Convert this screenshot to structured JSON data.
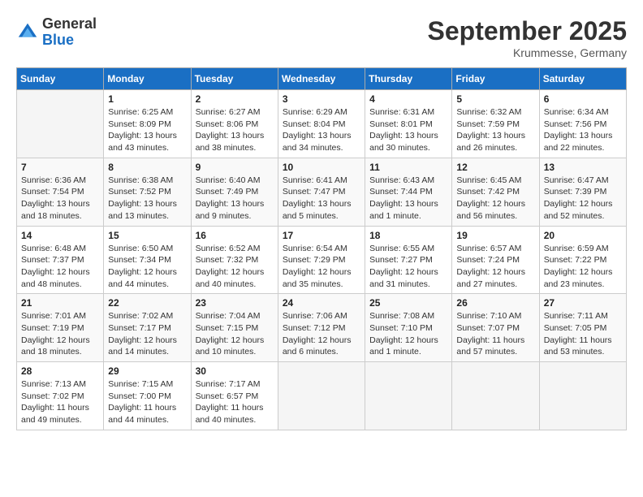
{
  "logo": {
    "general": "General",
    "blue": "Blue"
  },
  "title": "September 2025",
  "location": "Krummesse, Germany",
  "weekdays": [
    "Sunday",
    "Monday",
    "Tuesday",
    "Wednesday",
    "Thursday",
    "Friday",
    "Saturday"
  ],
  "weeks": [
    [
      {
        "day": "",
        "info": ""
      },
      {
        "day": "1",
        "info": "Sunrise: 6:25 AM\nSunset: 8:09 PM\nDaylight: 13 hours\nand 43 minutes."
      },
      {
        "day": "2",
        "info": "Sunrise: 6:27 AM\nSunset: 8:06 PM\nDaylight: 13 hours\nand 38 minutes."
      },
      {
        "day": "3",
        "info": "Sunrise: 6:29 AM\nSunset: 8:04 PM\nDaylight: 13 hours\nand 34 minutes."
      },
      {
        "day": "4",
        "info": "Sunrise: 6:31 AM\nSunset: 8:01 PM\nDaylight: 13 hours\nand 30 minutes."
      },
      {
        "day": "5",
        "info": "Sunrise: 6:32 AM\nSunset: 7:59 PM\nDaylight: 13 hours\nand 26 minutes."
      },
      {
        "day": "6",
        "info": "Sunrise: 6:34 AM\nSunset: 7:56 PM\nDaylight: 13 hours\nand 22 minutes."
      }
    ],
    [
      {
        "day": "7",
        "info": "Sunrise: 6:36 AM\nSunset: 7:54 PM\nDaylight: 13 hours\nand 18 minutes."
      },
      {
        "day": "8",
        "info": "Sunrise: 6:38 AM\nSunset: 7:52 PM\nDaylight: 13 hours\nand 13 minutes."
      },
      {
        "day": "9",
        "info": "Sunrise: 6:40 AM\nSunset: 7:49 PM\nDaylight: 13 hours\nand 9 minutes."
      },
      {
        "day": "10",
        "info": "Sunrise: 6:41 AM\nSunset: 7:47 PM\nDaylight: 13 hours\nand 5 minutes."
      },
      {
        "day": "11",
        "info": "Sunrise: 6:43 AM\nSunset: 7:44 PM\nDaylight: 13 hours\nand 1 minute."
      },
      {
        "day": "12",
        "info": "Sunrise: 6:45 AM\nSunset: 7:42 PM\nDaylight: 12 hours\nand 56 minutes."
      },
      {
        "day": "13",
        "info": "Sunrise: 6:47 AM\nSunset: 7:39 PM\nDaylight: 12 hours\nand 52 minutes."
      }
    ],
    [
      {
        "day": "14",
        "info": "Sunrise: 6:48 AM\nSunset: 7:37 PM\nDaylight: 12 hours\nand 48 minutes."
      },
      {
        "day": "15",
        "info": "Sunrise: 6:50 AM\nSunset: 7:34 PM\nDaylight: 12 hours\nand 44 minutes."
      },
      {
        "day": "16",
        "info": "Sunrise: 6:52 AM\nSunset: 7:32 PM\nDaylight: 12 hours\nand 40 minutes."
      },
      {
        "day": "17",
        "info": "Sunrise: 6:54 AM\nSunset: 7:29 PM\nDaylight: 12 hours\nand 35 minutes."
      },
      {
        "day": "18",
        "info": "Sunrise: 6:55 AM\nSunset: 7:27 PM\nDaylight: 12 hours\nand 31 minutes."
      },
      {
        "day": "19",
        "info": "Sunrise: 6:57 AM\nSunset: 7:24 PM\nDaylight: 12 hours\nand 27 minutes."
      },
      {
        "day": "20",
        "info": "Sunrise: 6:59 AM\nSunset: 7:22 PM\nDaylight: 12 hours\nand 23 minutes."
      }
    ],
    [
      {
        "day": "21",
        "info": "Sunrise: 7:01 AM\nSunset: 7:19 PM\nDaylight: 12 hours\nand 18 minutes."
      },
      {
        "day": "22",
        "info": "Sunrise: 7:02 AM\nSunset: 7:17 PM\nDaylight: 12 hours\nand 14 minutes."
      },
      {
        "day": "23",
        "info": "Sunrise: 7:04 AM\nSunset: 7:15 PM\nDaylight: 12 hours\nand 10 minutes."
      },
      {
        "day": "24",
        "info": "Sunrise: 7:06 AM\nSunset: 7:12 PM\nDaylight: 12 hours\nand 6 minutes."
      },
      {
        "day": "25",
        "info": "Sunrise: 7:08 AM\nSunset: 7:10 PM\nDaylight: 12 hours\nand 1 minute."
      },
      {
        "day": "26",
        "info": "Sunrise: 7:10 AM\nSunset: 7:07 PM\nDaylight: 11 hours\nand 57 minutes."
      },
      {
        "day": "27",
        "info": "Sunrise: 7:11 AM\nSunset: 7:05 PM\nDaylight: 11 hours\nand 53 minutes."
      }
    ],
    [
      {
        "day": "28",
        "info": "Sunrise: 7:13 AM\nSunset: 7:02 PM\nDaylight: 11 hours\nand 49 minutes."
      },
      {
        "day": "29",
        "info": "Sunrise: 7:15 AM\nSunset: 7:00 PM\nDaylight: 11 hours\nand 44 minutes."
      },
      {
        "day": "30",
        "info": "Sunrise: 7:17 AM\nSunset: 6:57 PM\nDaylight: 11 hours\nand 40 minutes."
      },
      {
        "day": "",
        "info": ""
      },
      {
        "day": "",
        "info": ""
      },
      {
        "day": "",
        "info": ""
      },
      {
        "day": "",
        "info": ""
      }
    ]
  ]
}
